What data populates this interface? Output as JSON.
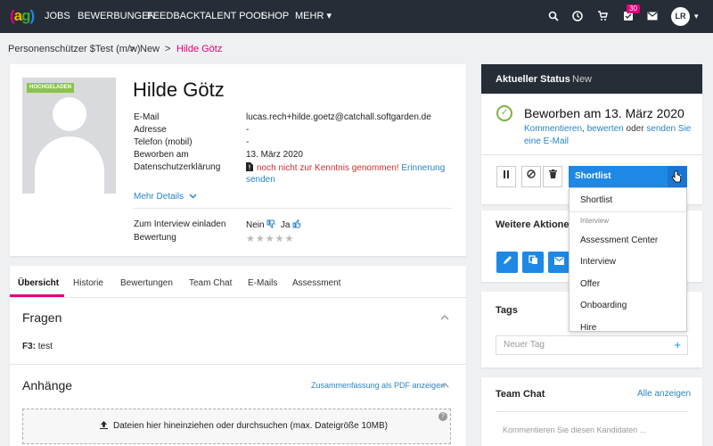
{
  "nav": {
    "logo": [
      "(",
      "a",
      "g",
      ")"
    ],
    "items": [
      "JOBS",
      "BEWERBUNGEN",
      "FEEDBACK",
      "TALENT POOL",
      "SHOP",
      "MEHR ▾"
    ],
    "tasks_badge": "30",
    "avatar": "LR",
    "avatar_caret": "▾"
  },
  "breadcrumb": [
    "Personenschützer $Test (m/w)",
    ">",
    "New",
    ">",
    "Hilde Götz"
  ],
  "candidate": {
    "photo_badge": "HOCHGELADEN",
    "name": "Hilde Götz",
    "labels": [
      "E-Mail",
      "Adresse",
      "Telefon (mobil)",
      "Beworben am",
      "Datenschutzerklärung"
    ],
    "email": "lucas.rech+hilde.goetz@catchall.softgarden.de",
    "address": "-",
    "phone": "-",
    "applied": "13. März 2020",
    "privacy_text": "noch nicht zur Kenntnis genommen!",
    "privacy_link_1": "Erinnerung",
    "privacy_link_2": "senden",
    "more_details": "Mehr Details",
    "interview_label": "Zum Interview einladen",
    "no": "Nein",
    "yes": "Ja",
    "rating_label": "Bewertung",
    "stars": "★★★★★"
  },
  "tabs": [
    "Übersicht",
    "Historie",
    "Bewertungen",
    "Team Chat",
    "E-Mails",
    "Assessment"
  ],
  "sections": {
    "questions_title": "Fragen",
    "question_label": "F3:",
    "question_answer": "test",
    "attachments_title": "Anhänge",
    "pdf_link": "Zusammenfassung als PDF anzeigen",
    "dropzone": "Dateien hier hineinziehen oder durchsuchen (max. Dateigröße 10MB)"
  },
  "status": {
    "title": "Aktueller Status",
    "status": "New",
    "headline": "Beworben am 13. März 2020",
    "links": [
      "Kommentieren",
      "bewerten",
      "senden Sie"
    ],
    "sep": ", ",
    "or": "oder",
    "line2": "eine E-Mail",
    "selected": "Shortlist"
  },
  "dropdown": {
    "items": [
      "Shortlist",
      "Interview",
      "Assessment Center",
      "Interview",
      "Offer",
      "Onboarding",
      "Hire"
    ]
  },
  "right": {
    "actions_title": "Weitere Aktionen",
    "tags_title": "Tags",
    "tag_placeholder": "Neuer Tag",
    "plus": "+",
    "chat_title": "Team Chat",
    "show_all": "Alle anzeigen",
    "chat_placeholder": "Kommentieren Sie diesen Kandidaten ..."
  },
  "colors": {
    "accent": "#e2007a",
    "primary": "#1e88e5",
    "nav": "#262d36",
    "success": "#7cb342",
    "error": "#d32f2f"
  }
}
